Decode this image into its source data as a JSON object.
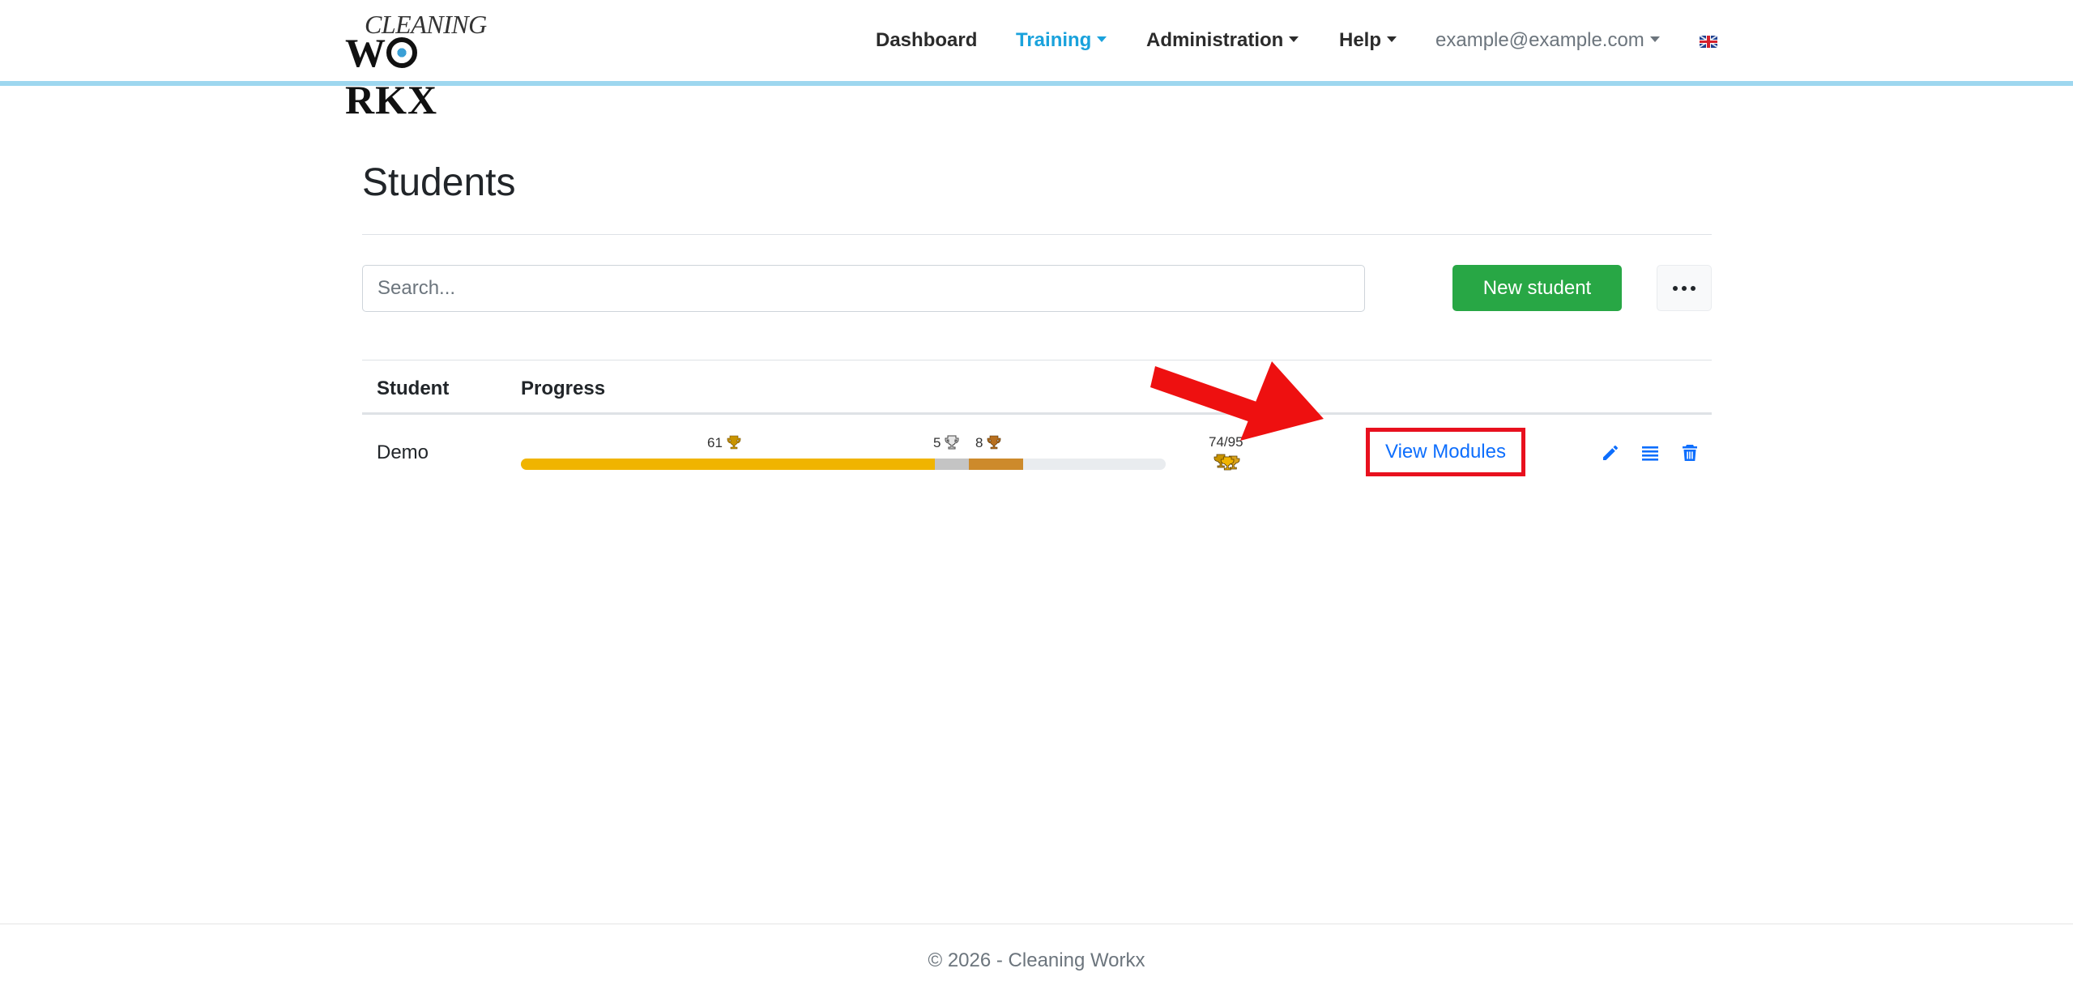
{
  "brand": {
    "logo_top": "CLEANING",
    "logo_bottom_w": "W",
    "logo_bottom_rest": "RKX"
  },
  "nav": {
    "dashboard": "Dashboard",
    "training": "Training",
    "administration": "Administration",
    "help": "Help",
    "user_email": "example@example.com",
    "language_icon": "uk-flag-icon"
  },
  "page": {
    "title": "Students"
  },
  "search": {
    "placeholder": "Search..."
  },
  "actions": {
    "new_student": "New student",
    "more_icon": "ellipsis-icon"
  },
  "table": {
    "headers": {
      "student": "Student",
      "progress": "Progress"
    },
    "rows": [
      {
        "student": "Demo",
        "progress": {
          "gold_count": "61",
          "silver_count": "5",
          "bronze_count": "8",
          "total": "74/95",
          "gold_fraction": 0.642,
          "silver_fraction": 0.053,
          "bronze_fraction": 0.084
        },
        "view_modules": "View Modules",
        "icons": [
          "pencil-icon",
          "list-icon",
          "trash-icon"
        ]
      }
    ]
  },
  "colors": {
    "accent": "#1aa2dc",
    "gold": "#f0b400",
    "silver": "#c4c4c4",
    "bronze": "#cd8a2b",
    "success": "#28a745",
    "link": "#0d6efd",
    "highlight": "#e8101e"
  },
  "footer": {
    "text": "© 2026 - Cleaning Workx"
  }
}
